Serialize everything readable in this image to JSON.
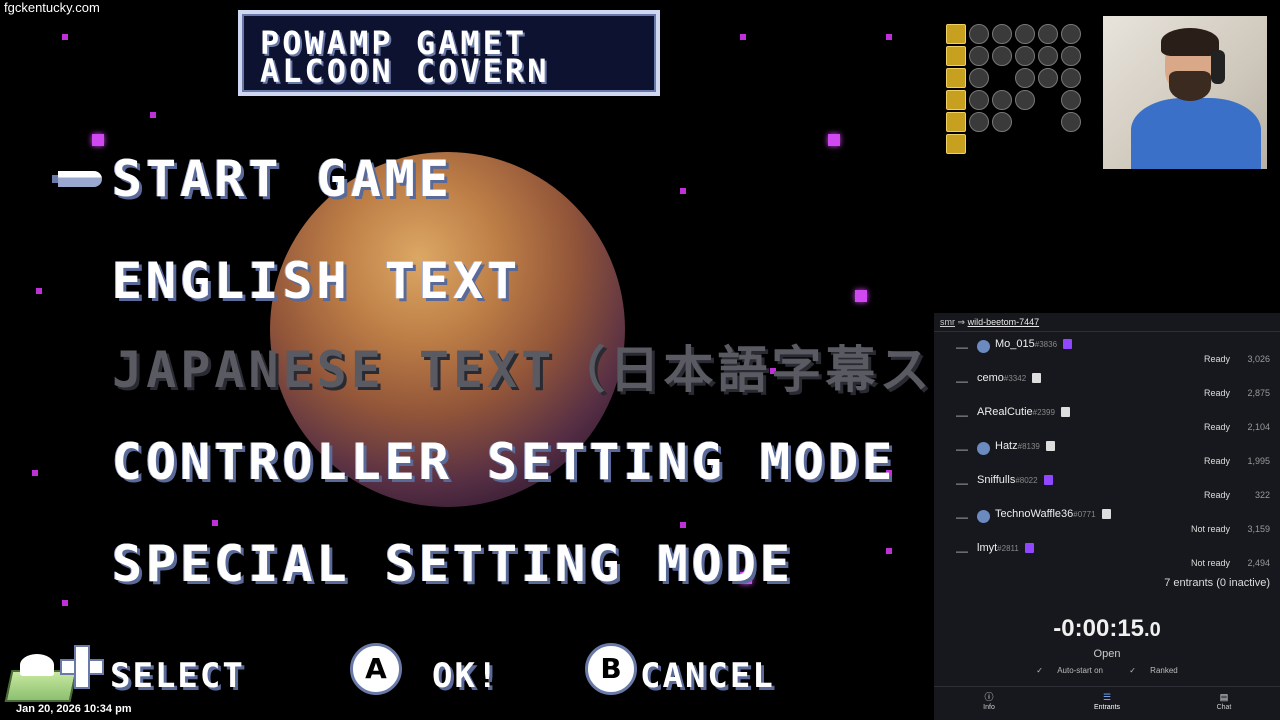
{
  "stream": {
    "watermark": "fgckentucky.com",
    "timestamp": "Jan 20, 2026 10:34 pm"
  },
  "game": {
    "title_line1": "POWAMP GAMET",
    "title_line2": "ALCOON COVERN",
    "menu": [
      {
        "label": "START GAME",
        "selected": true,
        "enabled": true
      },
      {
        "label": "ENGLISH TEXT",
        "enabled": true
      },
      {
        "label": "JAPANESE TEXT（日本語字幕スーパー）",
        "enabled": false
      },
      {
        "label": "CONTROLLER SETTING MODE",
        "enabled": true
      },
      {
        "label": "SPECIAL SETTING MODE",
        "enabled": true
      }
    ],
    "hints": {
      "select": "SELECT",
      "a_button": "A",
      "ok": "OK!",
      "b_button": "B",
      "cancel": "CANCEL"
    }
  },
  "race": {
    "header_from": "smr",
    "header_arrow": "⇒",
    "header_room": "wild-beetom-7447",
    "entrants": [
      {
        "name": "Mo_015",
        "disc": "#3836",
        "status": "Ready",
        "score": "3,026",
        "twitch": true,
        "avatar": true
      },
      {
        "name": "cemo",
        "disc": "#3342",
        "status": "Ready",
        "score": "2,875",
        "twitch": false,
        "avatar": false
      },
      {
        "name": "ARealCutie",
        "disc": "#2399",
        "status": "Ready",
        "score": "2,104",
        "twitch": false,
        "avatar": false
      },
      {
        "name": "Hatz",
        "disc": "#8139",
        "status": "Ready",
        "score": "1,995",
        "twitch": false,
        "avatar": true
      },
      {
        "name": "Sniffulls",
        "disc": "#8022",
        "status": "Ready",
        "score": "322",
        "twitch": true,
        "avatar": false
      },
      {
        "name": "TechnoWaffle36",
        "disc": "#0771",
        "status": "Not ready",
        "score": "3,159",
        "twitch": false,
        "avatar": true
      },
      {
        "name": "lmyt",
        "disc": "#2811",
        "status": "Not ready",
        "score": "2,494",
        "twitch": true,
        "avatar": false
      }
    ],
    "entrant_count": "7 entrants (0 inactive)",
    "timer_main": "-0:00:15",
    "timer_frac": ".0",
    "state": "Open",
    "flag_autostart": "Auto-start on",
    "flag_ranked": "Ranked",
    "nav": [
      {
        "label": "Info",
        "icon": "info-icon"
      },
      {
        "label": "Entrants",
        "icon": "list-icon"
      },
      {
        "label": "Chat",
        "icon": "chat-icon"
      }
    ]
  },
  "colors": {
    "twitch_purple": "#9146ff",
    "star_magenta": "#d048f0"
  }
}
